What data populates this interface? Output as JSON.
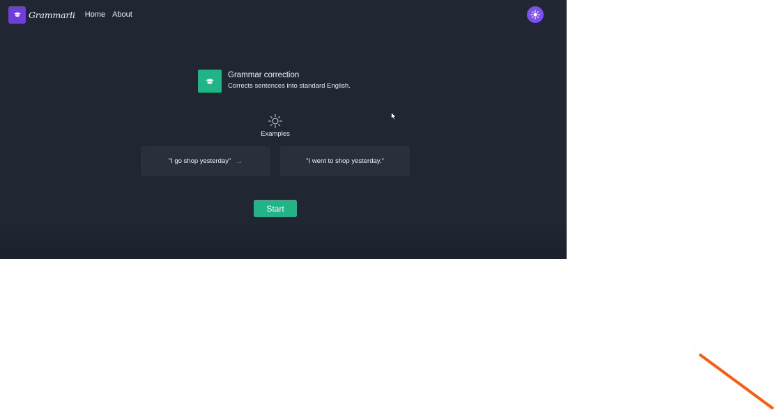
{
  "nav": {
    "brand": "Grammarli",
    "links": [
      {
        "label": "Home"
      },
      {
        "label": "About"
      }
    ]
  },
  "tool": {
    "title": "Grammar correction",
    "description": "Corrects sentences into standard English."
  },
  "examples": {
    "label": "Examples",
    "input": "\"I go shop yesterday\"",
    "output": "\"I went to shop yesterday.\""
  },
  "start_button": {
    "label": "Start"
  },
  "icons": {
    "logo": "graduation-cap-icon",
    "theme_toggle": "sun-icon",
    "tool": "graduation-cap-icon",
    "examples": "sun-icon",
    "arrow": "arrow-right-icon"
  },
  "colors": {
    "background": "#202733",
    "accent_purple": "#7c4ff0",
    "accent_green": "#20b486",
    "card": "#2a303b",
    "annotation_stroke": "#ff5a0a"
  }
}
